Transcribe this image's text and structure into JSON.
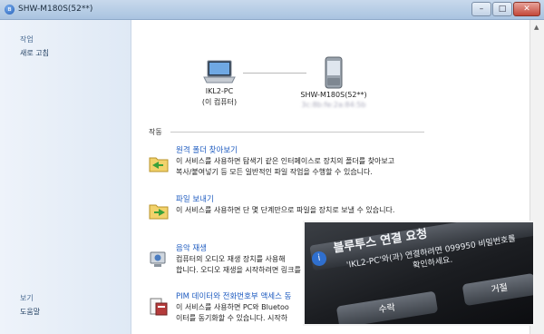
{
  "window": {
    "title": "SHW-M180S(52**)",
    "min_glyph": "–",
    "max_glyph": "□",
    "close_glyph": "✕",
    "bluetooth_glyph": "ʙ"
  },
  "sidebar": {
    "tasks_heading": "작업",
    "refresh_label": "새로 고침",
    "see_also_heading": "보기",
    "help_label": "도움말"
  },
  "devices": {
    "computer_name": "IKL2-PC",
    "computer_sub": "(이 컴퓨터)",
    "phone_name": "SHW-M180S(52**)",
    "phone_sub": "3c:8b:fe:2a:84:5b"
  },
  "actions": {
    "heading": "작동",
    "items": [
      {
        "title": "원격 폴더 찾아보기",
        "desc_line1": "이 서비스를 사용하면 탐색기 같은 인터페이스로 장치의 폴더를 찾아보고",
        "desc_line2": "복사/붙여넣기 등 모든 일반적인 파일 작업을 수행할 수 있습니다."
      },
      {
        "title": "파일 보내기",
        "desc_line1": "이 서비스를 사용하면 단 몇 단계만으로 파일을 장치로 보낼 수 있습니다.",
        "desc_line2": ""
      },
      {
        "title": "음악 재생",
        "desc_line1": "컴퓨터의 오디오 재생 장치를 사용해",
        "desc_line2": "합니다. 오디오 재생을 시작하려면 링크를"
      },
      {
        "title": "PIM 데이터와 전화번호부 액세스 동",
        "desc_line1": "이 서비스를 사용하면 PC와 Bluetoo",
        "desc_line2": "이터를 동기화할 수 있습니다. 시작하"
      }
    ]
  },
  "photo": {
    "title": "블루투스 연결 요청",
    "message_line1": "'IKL2-PC'와(과) 연결하려면 099950 비밀번호를",
    "message_line2": "확인하세요.",
    "accept_label": "수락",
    "reject_label": "거절"
  },
  "colors": {
    "link": "#1f5cc0",
    "sidebar_bg": "#e6eef8",
    "titlebar": "#bcd0e8"
  }
}
